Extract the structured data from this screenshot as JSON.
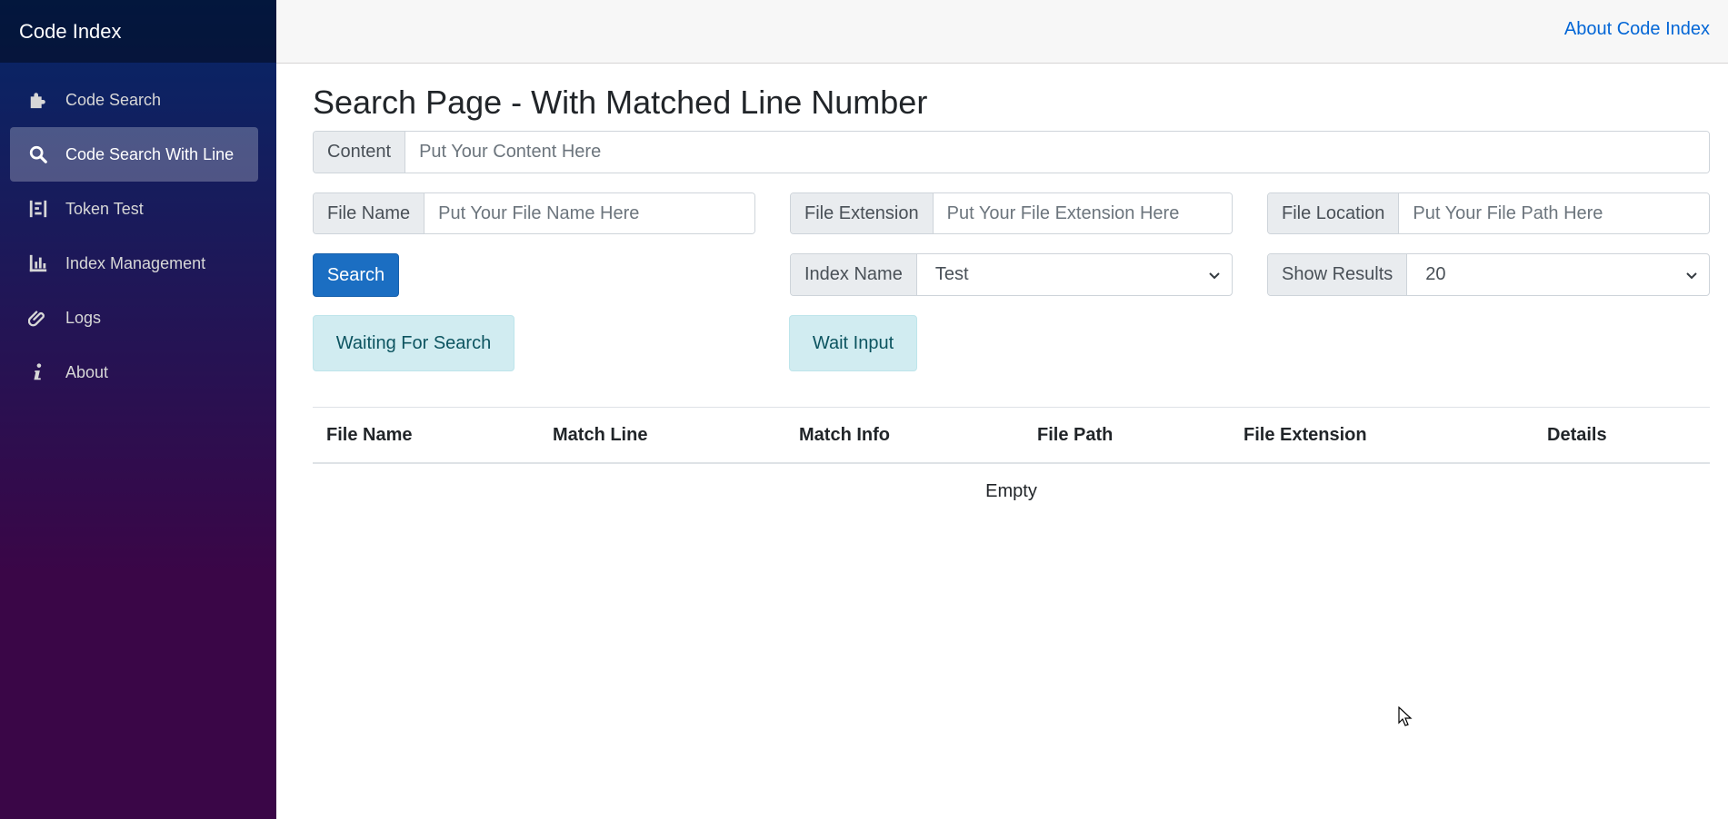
{
  "brand": "Code Index",
  "sidebar": {
    "items": [
      {
        "label": "Code Search",
        "icon": "puzzle-icon"
      },
      {
        "label": "Code Search With Line",
        "icon": "search-icon",
        "active": true
      },
      {
        "label": "Token Test",
        "icon": "tokens-icon"
      },
      {
        "label": "Index Management",
        "icon": "bar-chart-icon"
      },
      {
        "label": "Logs",
        "icon": "paperclip-icon"
      },
      {
        "label": "About",
        "icon": "info-icon"
      }
    ]
  },
  "topbar": {
    "about_link": "About Code Index"
  },
  "page": {
    "title": "Search Page - With Matched Line Number"
  },
  "form": {
    "content": {
      "label": "Content",
      "placeholder": "Put Your Content Here",
      "value": ""
    },
    "file_name": {
      "label": "File Name",
      "placeholder": "Put Your File Name Here",
      "value": ""
    },
    "file_extension": {
      "label": "File Extension",
      "placeholder": "Put Your File Extension Here",
      "value": ""
    },
    "file_location": {
      "label": "File Location",
      "placeholder": "Put Your File Path Here",
      "value": ""
    },
    "index_name": {
      "label": "Index Name",
      "selected": "Test"
    },
    "show_results": {
      "label": "Show Results",
      "selected": "20"
    },
    "search_button": "Search"
  },
  "status": {
    "search_state": "Waiting For Search",
    "input_state": "Wait Input"
  },
  "table": {
    "columns": [
      "File Name",
      "Match Line",
      "Match Info",
      "File Path",
      "File Extension",
      "Details"
    ],
    "empty_text": "Empty"
  },
  "colors": {
    "sidebar_top": "#052767",
    "sidebar_bottom": "#3a0647",
    "primary": "#1b6ec2",
    "link": "#0366d6",
    "info_bg": "#d1ecf1"
  }
}
